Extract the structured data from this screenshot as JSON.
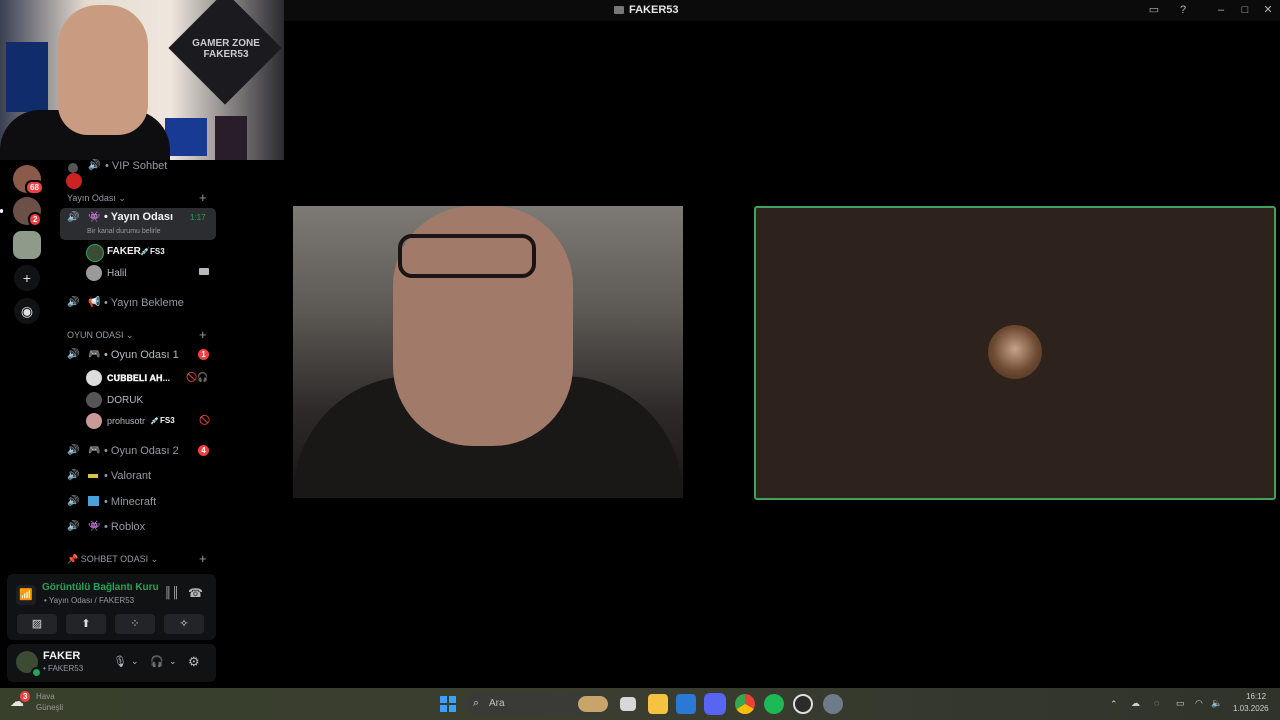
{
  "window": {
    "title": "FAKER53"
  },
  "titlebar_icons": [
    "inbox-icon",
    "help-icon",
    "minimize-icon",
    "maximize-icon",
    "close-icon"
  ],
  "webcam_overlay": {
    "sign_text": "GAMER ZONE FAKER53"
  },
  "servers": [
    {
      "badge": "68"
    },
    {
      "badge": "2"
    },
    {
      "badge": ""
    }
  ],
  "channels": {
    "vip": "• VIP Sohbet",
    "cat_yayin": "Yayın Odası",
    "yayin_odasi": {
      "label": "• Yayın Odası",
      "time": "1:17",
      "status": "Bir kanal durumu belirle"
    },
    "yayin_users": [
      {
        "name": "FAKER",
        "tag": "FS3"
      },
      {
        "name": "Halil",
        "tag": ""
      }
    ],
    "yayin_bekleme": "• Yayın Bekleme",
    "cat_oyun": "OYUN ODASI",
    "oyun1": {
      "label": "• Oyun Odası 1",
      "badge": "1"
    },
    "oyun1_users": [
      {
        "name": "𝐂𝐔̈𝐁𝐁𝐄𝐋𝐈̇ 𝐀𝐇...",
        "tag": ""
      },
      {
        "name": "DORUK",
        "tag": ""
      },
      {
        "name": "prohusotr",
        "tag": "FS3"
      }
    ],
    "oyun2": {
      "label": "• Oyun Odası 2",
      "badge": "4"
    },
    "valorant": "• Valorant",
    "minecraft": "• Minecraft",
    "roblox": "• Roblox",
    "cat_sohbet": "SOHBET ODASI"
  },
  "voice_panel": {
    "status": "Görüntülü Bağlantı Kuru",
    "location": "• Yayın Odası / FAKER53"
  },
  "user_panel": {
    "name": "FAKER",
    "sub": "• FAKER53"
  },
  "taskbar": {
    "search_placeholder": "Ara",
    "weather_badge": "3",
    "weather_text": "Hava",
    "weather_sub": "Güneşli",
    "time": "16:12",
    "date": "1.03.2026"
  },
  "colors": {
    "accent_green": "#23a55a",
    "danger": "#f23f43",
    "speaking_border": "#3fa35c"
  }
}
